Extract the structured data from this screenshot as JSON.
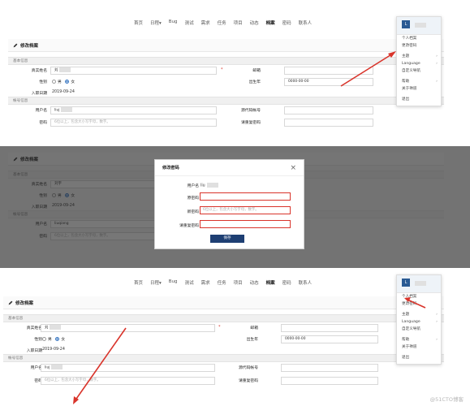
{
  "nav": [
    "首页",
    "日程",
    "Bug",
    "测试",
    "需求",
    "任务",
    "项目",
    "动态",
    "档案",
    "密码",
    "联系人"
  ],
  "nav_dropdown_mark": "▾",
  "user_menu": {
    "avatar_initial": "L",
    "groups": [
      [
        "个人档案",
        "更改密码"
      ],
      [
        "主题",
        "Language",
        "自定义导航"
      ],
      [
        "帮助",
        "关于禅道"
      ],
      [
        "退出"
      ]
    ],
    "submenu_items": [
      "主题",
      "Language",
      "帮助"
    ],
    "chevron": "›"
  },
  "form": {
    "page_title": "修改档案",
    "section_basic": "基本信息",
    "section_account": "帐号信息",
    "realname_label": "真实姓名",
    "realname_value": "刘",
    "realname_value_2": "刘宇",
    "gender_label": "性别",
    "gender_male": "男",
    "gender_female": "女",
    "join_label": "入职日期",
    "join_value": "2019-09-24",
    "email_label": "邮箱",
    "birthday_label": "出生年",
    "birthday_value": "0000-00-00",
    "account_label": "用户名",
    "account_value": "liuj",
    "account_value_2": "liuqiang",
    "source_label": "源代码帐号",
    "password_label": "密码",
    "password_placeholder": "6位以上，包含大小写字母，数字。",
    "repeat_label": "请重复密码",
    "required_mark": "*"
  },
  "modal": {
    "title": "修改密码",
    "close": "×",
    "account_label": "用户名",
    "account_value": "liu",
    "original_label": "原密码",
    "new_label": "新密码",
    "new_placeholder": "6位以上，包含大小写字母，数字。",
    "repeat_label": "请重复密码",
    "save_label": "保存"
  },
  "watermark": "@51CTO博客",
  "colors": {
    "arrow": "#d9342b",
    "accent": "#1e3f73"
  }
}
